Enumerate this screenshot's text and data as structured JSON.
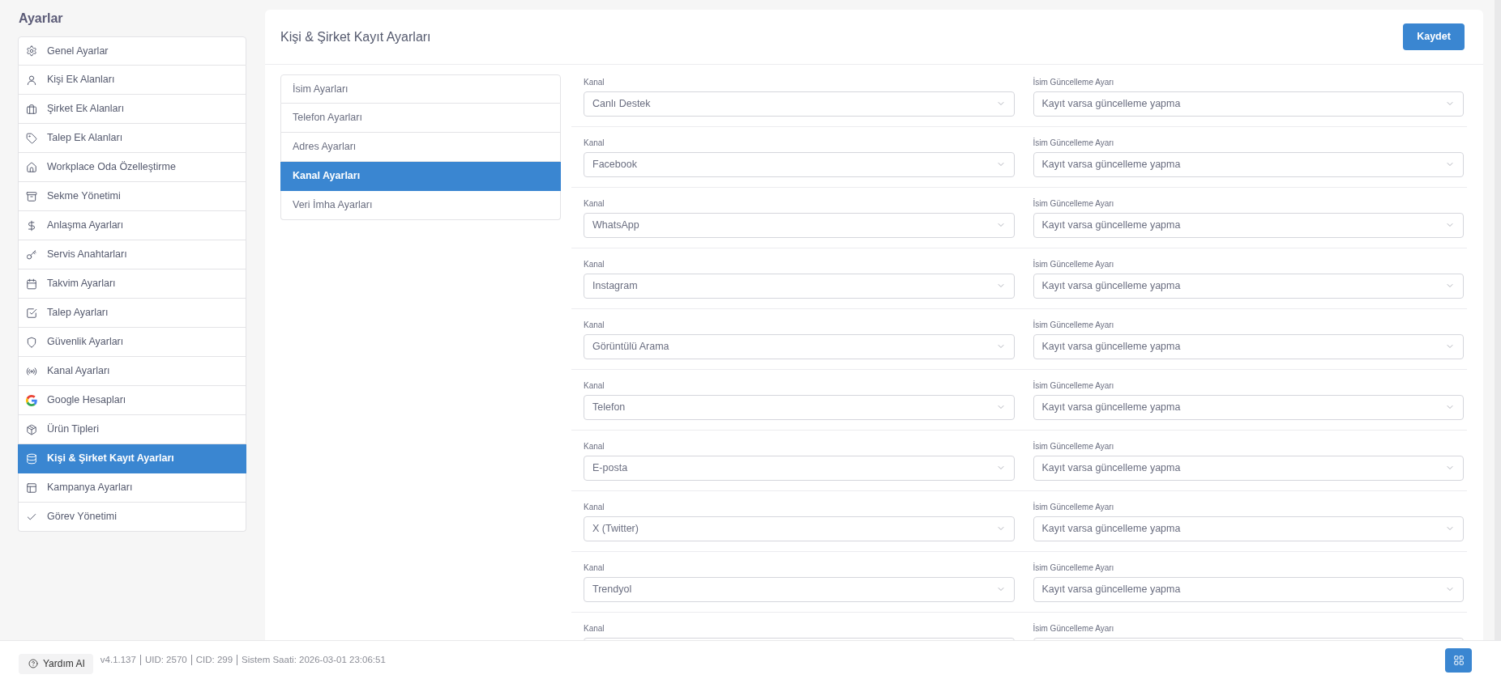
{
  "sidebar": {
    "title": "Ayarlar",
    "items": [
      {
        "label": "Genel Ayarlar",
        "selected": false
      },
      {
        "label": "Kişi Ek Alanları",
        "selected": false
      },
      {
        "label": "Şirket Ek Alanları",
        "selected": false
      },
      {
        "label": "Talep Ek Alanları",
        "selected": false
      },
      {
        "label": "Workplace Oda Özelleştirme",
        "selected": false
      },
      {
        "label": "Sekme Yönetimi",
        "selected": false
      },
      {
        "label": "Anlaşma Ayarları",
        "selected": false
      },
      {
        "label": "Servis Anahtarları",
        "selected": false
      },
      {
        "label": "Takvim Ayarları",
        "selected": false
      },
      {
        "label": "Talep Ayarları",
        "selected": false
      },
      {
        "label": "Güvenlik Ayarları",
        "selected": false
      },
      {
        "label": "Kanal Ayarları",
        "selected": false
      },
      {
        "label": "Google Hesapları",
        "selected": false
      },
      {
        "label": "Ürün Tipleri",
        "selected": false
      },
      {
        "label": "Kişi & Şirket Kayıt Ayarları",
        "selected": true
      },
      {
        "label": "Kampanya Ayarları",
        "selected": false
      },
      {
        "label": "Görev Yönetimi",
        "selected": false
      }
    ]
  },
  "main": {
    "title": "Kişi & Şirket Kayıt Ayarları",
    "save_button": "Kaydet",
    "tabs": [
      {
        "label": "İsim Ayarları",
        "selected": false
      },
      {
        "label": "Telefon Ayarları",
        "selected": false
      },
      {
        "label": "Adres Ayarları",
        "selected": false
      },
      {
        "label": "Kanal Ayarları",
        "selected": true
      },
      {
        "label": "Veri İmha Ayarları",
        "selected": false
      }
    ],
    "rows": [
      {
        "channel": {
          "label": "Kanal",
          "value": "Canlı Destek"
        },
        "name_update": {
          "label": "İsim Güncelleme Ayarı",
          "value": "Kayıt varsa güncelleme yapma"
        }
      },
      {
        "channel": {
          "label": "Kanal",
          "value": "Facebook"
        },
        "name_update": {
          "label": "İsim Güncelleme Ayarı",
          "value": "Kayıt varsa güncelleme yapma"
        }
      },
      {
        "channel": {
          "label": "Kanal",
          "value": "WhatsApp"
        },
        "name_update": {
          "label": "İsim Güncelleme Ayarı",
          "value": "Kayıt varsa güncelleme yapma"
        }
      },
      {
        "channel": {
          "label": "Kanal",
          "value": "Instagram"
        },
        "name_update": {
          "label": "İsim Güncelleme Ayarı",
          "value": "Kayıt varsa güncelleme yapma"
        }
      },
      {
        "channel": {
          "label": "Kanal",
          "value": "Görüntülü Arama"
        },
        "name_update": {
          "label": "İsim Güncelleme Ayarı",
          "value": "Kayıt varsa güncelleme yapma"
        }
      },
      {
        "channel": {
          "label": "Kanal",
          "value": "Telefon"
        },
        "name_update": {
          "label": "İsim Güncelleme Ayarı",
          "value": "Kayıt varsa güncelleme yapma"
        }
      },
      {
        "channel": {
          "label": "Kanal",
          "value": "E-posta"
        },
        "name_update": {
          "label": "İsim Güncelleme Ayarı",
          "value": "Kayıt varsa güncelleme yapma"
        }
      },
      {
        "channel": {
          "label": "Kanal",
          "value": "X (Twitter)"
        },
        "name_update": {
          "label": "İsim Güncelleme Ayarı",
          "value": "Kayıt varsa güncelleme yapma"
        }
      },
      {
        "channel": {
          "label": "Kanal",
          "value": "Trendyol"
        },
        "name_update": {
          "label": "İsim Güncelleme Ayarı",
          "value": "Kayıt varsa güncelleme yapma"
        }
      },
      {
        "channel": {
          "label": "Kanal"
        },
        "name_update": {
          "label": "İsim Güncelleme Ayarı"
        }
      }
    ]
  },
  "footer": {
    "help_button": "Yardım AI",
    "info": [
      "v4.1.137",
      "UID: 2570",
      "CID: 299",
      "Sistem Saati: 2026-03-01 23:06:51"
    ]
  }
}
